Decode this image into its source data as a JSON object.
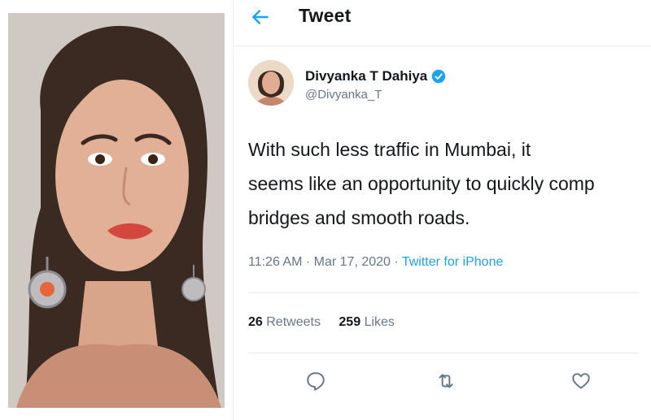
{
  "colors": {
    "accent": "#1da1f2",
    "text_primary": "#14171a",
    "text_secondary": "#657786",
    "divider": "#e6ecf0",
    "verified_badge": "#1da1f2"
  },
  "photo": {
    "description_icon": "portrait-photo"
  },
  "tweet_view": {
    "header": {
      "back_icon": "arrow-left-icon",
      "title": "Tweet"
    },
    "author": {
      "name": "Divyanka T Dahiya",
      "handle": "@Divyanka_T",
      "verified": true
    },
    "text_lines": [
      "With such less traffic in Mumbai, it",
      "seems like an opportunity to quickly comp",
      "bridges and smooth roads."
    ],
    "meta": {
      "time": "11:26 AM",
      "separator": " · ",
      "date": "Mar 17, 2020",
      "source": "Twitter for iPhone"
    },
    "stats": {
      "retweets_count": "26",
      "retweets_label": "Retweets",
      "likes_count": "259",
      "likes_label": "Likes"
    },
    "actions": [
      {
        "name": "reply-icon"
      },
      {
        "name": "retweet-icon"
      },
      {
        "name": "like-icon"
      }
    ]
  }
}
